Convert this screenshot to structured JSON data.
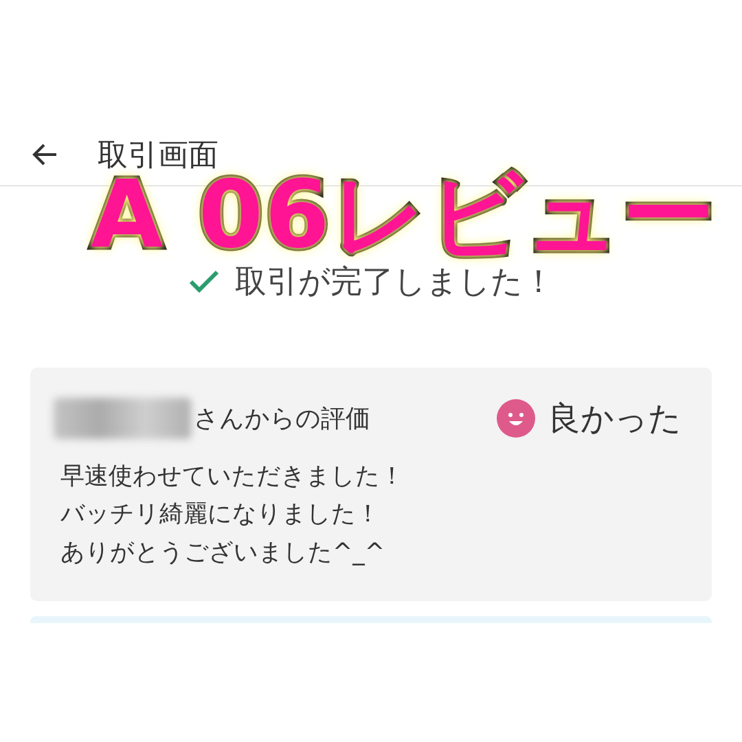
{
  "header": {
    "title": "取引画面"
  },
  "overlay_caption": "A 06レビュー",
  "status": {
    "kind": "complete",
    "text": "取引が完了しました！"
  },
  "review": {
    "reviewer_suffix": "さんからの評価",
    "rating": {
      "kind": "good",
      "label": "良かった"
    },
    "comment_lines": [
      "早速使わせていただきました！",
      "バッチリ綺麗になりました！",
      "ありがとうございました^_^"
    ]
  }
}
